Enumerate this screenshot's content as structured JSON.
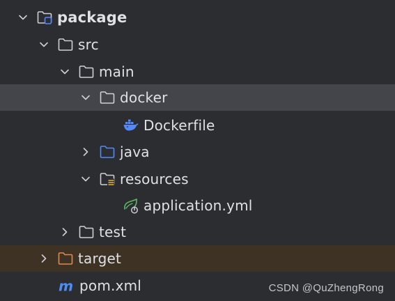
{
  "colors": {
    "background": "#2b2d30",
    "selected_row": "#43454a",
    "excluded_row": "#3d3223",
    "text": "#dfe1e5",
    "folder_default": "#ced0d6",
    "folder_source": "#548af7",
    "folder_excluded": "#e08855",
    "docker_blue": "#548af7",
    "spring_green": "#5fb865",
    "maven_blue": "#4d8cf5"
  },
  "tree": {
    "package": {
      "label": "package",
      "icon": "module-folder-icon",
      "expanded": true
    },
    "src": {
      "label": "src",
      "icon": "folder-icon",
      "expanded": true
    },
    "main": {
      "label": "main",
      "icon": "folder-icon",
      "expanded": true
    },
    "docker": {
      "label": "docker",
      "icon": "folder-icon",
      "expanded": true,
      "selected": true
    },
    "dockerfile": {
      "label": "Dockerfile",
      "icon": "docker-icon"
    },
    "java": {
      "label": "java",
      "icon": "source-folder-icon",
      "expanded": false
    },
    "resources": {
      "label": "resources",
      "icon": "resources-folder-icon",
      "expanded": true
    },
    "application_yml": {
      "label": "application.yml",
      "icon": "spring-config-icon"
    },
    "test": {
      "label": "test",
      "icon": "folder-icon",
      "expanded": false
    },
    "target": {
      "label": "target",
      "icon": "excluded-folder-icon",
      "expanded": false
    },
    "pom_xml": {
      "label": "pom.xml",
      "icon": "maven-icon"
    }
  },
  "watermark": "CSDN @QuZhengRong"
}
